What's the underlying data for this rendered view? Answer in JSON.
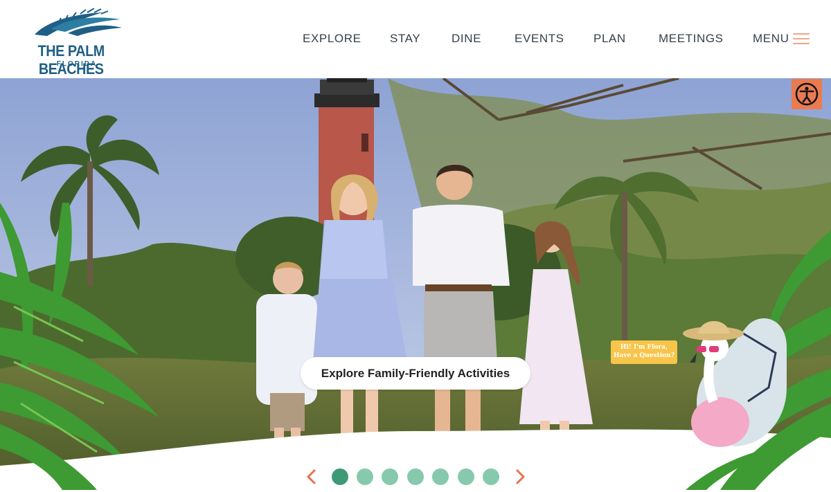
{
  "brand": {
    "title": "THE PALM BEACHES",
    "subtitle": "FLORIDA"
  },
  "nav": {
    "items": [
      {
        "label": "EXPLORE"
      },
      {
        "label": "STAY"
      },
      {
        "label": "DINE"
      },
      {
        "label": "EVENTS"
      },
      {
        "label": "PLAN"
      },
      {
        "label": "MEETINGS"
      }
    ],
    "menu_label": "MENU"
  },
  "hero": {
    "cta_label": "Explore Family-Friendly Activities",
    "chat_bubble_line1": "Hi! I'm Flora,",
    "chat_bubble_line2": "Have a Question?"
  },
  "carousel": {
    "slide_count": 7,
    "active_index": 0
  },
  "colors": {
    "brand_blue": "#1f5f86",
    "accent_orange": "#ea7b4f",
    "dot": "#86c9ad",
    "dot_active": "#3e9a76",
    "bubble": "#f7c54a"
  },
  "icons": {
    "accessibility": "accessibility-icon",
    "menu": "hamburger-icon",
    "prev": "chevron-left-icon",
    "next": "chevron-right-icon"
  }
}
